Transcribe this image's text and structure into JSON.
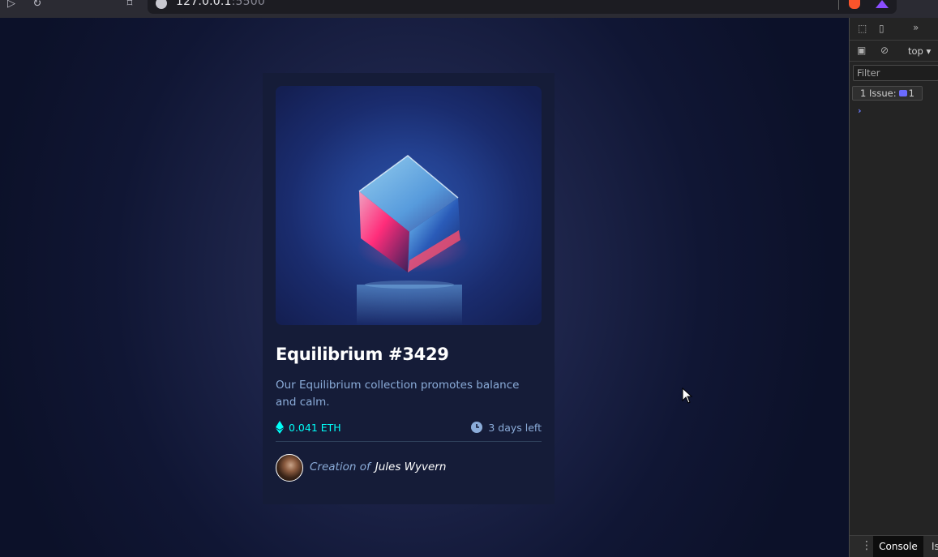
{
  "browser": {
    "url_host": "127.0.0.1",
    "url_port": ":5500"
  },
  "card": {
    "title": "Equilibrium #3429",
    "description": "Our Equilibrium collection promotes balance and calm.",
    "price": "0.041 ETH",
    "time_left": "3 days left",
    "creator_prefix": "Creation of",
    "creator_name": "Jules Wyvern",
    "colors": {
      "card_bg": "#151c38",
      "page_bg": "#0d1224",
      "cyan": "#00fff8",
      "soft_blue": "#8bacd9",
      "white": "#ffffff"
    }
  },
  "devtools": {
    "context": "top",
    "filter_placeholder": "Filter",
    "issues_label": "1 Issue:",
    "issues_count": "1",
    "tab_console": "Console",
    "tab_issues": "Is"
  }
}
